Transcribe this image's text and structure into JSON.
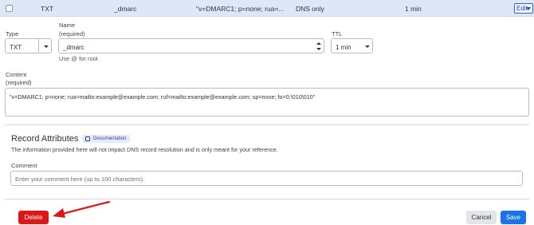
{
  "record_row": {
    "type": "TXT",
    "name": "_dmarc",
    "content": "\"v=DMARC1; p=none; rua=...",
    "proxy_status": "DNS only",
    "ttl": "1 min",
    "edit_label": "Edit"
  },
  "form": {
    "type_label": "Type",
    "type_value": "TXT",
    "name_label": "Name",
    "name_required": "(required)",
    "name_value": "_dmarc",
    "name_hint": "Use @ for root",
    "ttl_label": "TTL",
    "ttl_value": "1 min",
    "content_label": "Content",
    "content_required": "(required)",
    "content_value": "\"v=DMARC1; p=none; rua=mailto:example@example.com; ruf=mailto:example@example.com; sp=none; fo=0;\\010\\010\""
  },
  "attributes": {
    "title": "Record Attributes",
    "doc_label": "Documentation",
    "description": "The information provided here will not impact DNS record resolution and is only meant for your reference.",
    "comment_label": "Comment",
    "comment_placeholder": "Enter your comment here (up to 100 characters)."
  },
  "actions": {
    "delete_label": "Delete",
    "cancel_label": "Cancel",
    "save_label": "Save"
  },
  "colors": {
    "accent": "#1a73e8",
    "delete": "#e01515",
    "annotation_arrow": "#e01515"
  }
}
